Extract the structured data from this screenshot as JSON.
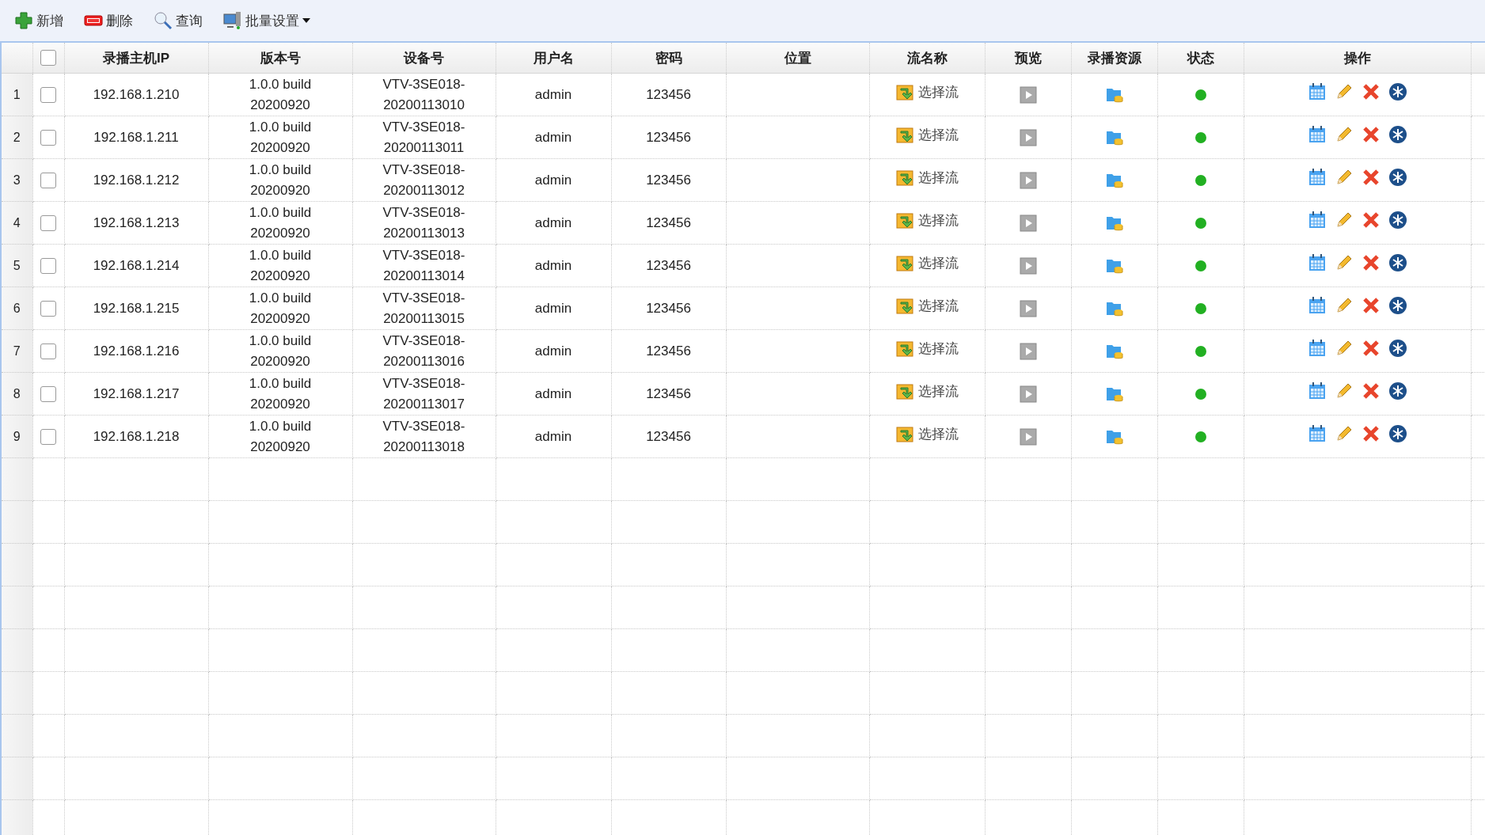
{
  "toolbar": [
    {
      "kind": "add",
      "label": "新增"
    },
    {
      "kind": "delete",
      "label": "删除"
    },
    {
      "kind": "search",
      "label": "查询"
    },
    {
      "kind": "batch",
      "label": "批量设置",
      "dropdown": true
    }
  ],
  "table": {
    "select_all": {
      "checked": false
    },
    "columns": [
      "录播主机IP",
      "版本号",
      "设备号",
      "用户名",
      "密码",
      "位置",
      "流名称",
      "预览",
      "录播资源",
      "状态",
      "操作"
    ],
    "rows": [
      {
        "index": "1",
        "checked": false,
        "ip": "192.168.1.210",
        "version": "1.0.0 build 20200920",
        "device": "VTV-3SE018-20200113010",
        "user": "admin",
        "password": "123456",
        "stream": "选择流",
        "color": "#22b022"
      },
      {
        "index": "2",
        "checked": false,
        "ip": "192.168.1.211",
        "version": "1.0.0 build 20200920",
        "device": "VTV-3SE018-20200113011",
        "user": "admin",
        "password": "123456",
        "stream": "选择流",
        "color": "#22b022"
      },
      {
        "index": "3",
        "checked": false,
        "ip": "192.168.1.212",
        "version": "1.0.0 build 20200920",
        "device": "VTV-3SE018-20200113012",
        "user": "admin",
        "password": "123456",
        "stream": "选择流",
        "color": "#22b022"
      },
      {
        "index": "4",
        "checked": false,
        "ip": "192.168.1.213",
        "version": "1.0.0 build 20200920",
        "device": "VTV-3SE018-20200113013",
        "user": "admin",
        "password": "123456",
        "stream": "选择流",
        "color": "#22b022"
      },
      {
        "index": "5",
        "checked": false,
        "ip": "192.168.1.214",
        "version": "1.0.0 build 20200920",
        "device": "VTV-3SE018-20200113014",
        "user": "admin",
        "password": "123456",
        "stream": "选择流",
        "color": "#22b022"
      },
      {
        "index": "6",
        "checked": false,
        "ip": "192.168.1.215",
        "version": "1.0.0 build 20200920",
        "device": "VTV-3SE018-20200113015",
        "user": "admin",
        "password": "123456",
        "stream": "选择流",
        "color": "#22b022"
      },
      {
        "index": "7",
        "checked": false,
        "ip": "192.168.1.216",
        "version": "1.0.0 build 20200920",
        "device": "VTV-3SE018-20200113016",
        "user": "admin",
        "password": "123456",
        "stream": "选择流",
        "color": "#22b022"
      },
      {
        "index": "8",
        "checked": false,
        "ip": "192.168.1.217",
        "version": "1.0.0 build 20200920",
        "device": "VTV-3SE018-20200113017",
        "user": "admin",
        "password": "123456",
        "stream": "选择流",
        "color": "#22b022"
      },
      {
        "index": "9",
        "checked": false,
        "ip": "192.168.1.218",
        "version": "1.0.0 build 20200920",
        "device": "VTV-3SE018-20200113018",
        "user": "admin",
        "password": "123456",
        "stream": "选择流",
        "color": "#22b022"
      }
    ]
  }
}
